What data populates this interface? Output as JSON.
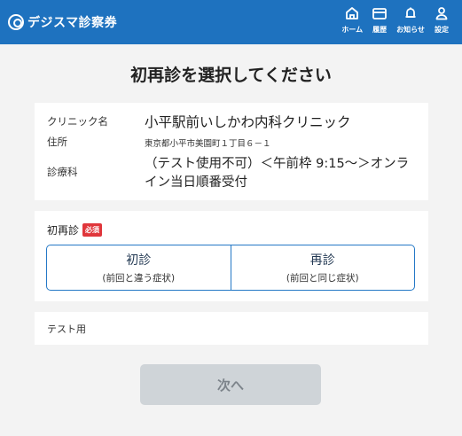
{
  "header": {
    "brand": "デジスマ診察券",
    "nav": [
      {
        "label": "ホーム",
        "icon": "home-icon"
      },
      {
        "label": "履歴",
        "icon": "card-icon"
      },
      {
        "label": "お知らせ",
        "icon": "bell-icon"
      },
      {
        "label": "設定",
        "icon": "user-icon"
      }
    ],
    "brand_color": "#1e72bf"
  },
  "page": {
    "title": "初再診を選択してください"
  },
  "clinic_info": {
    "clinic_label": "クリニック名",
    "clinic_value": "小平駅前いしかわ内科クリニック",
    "address_label": "住所",
    "address_value": "東京都小平市美園町１丁目６－１",
    "dept_label": "診療科",
    "dept_value": "（テスト使用不可）＜午前枠 9:15〜＞オンライン当日順番受付"
  },
  "visit_type": {
    "label": "初再診",
    "required_badge": "必須",
    "options": [
      {
        "main": "初診",
        "sub": "(前回と違う症状)"
      },
      {
        "main": "再診",
        "sub": "(前回と同じ症状)"
      }
    ]
  },
  "note": {
    "text": "テスト用"
  },
  "actions": {
    "next_label": "次へ"
  }
}
